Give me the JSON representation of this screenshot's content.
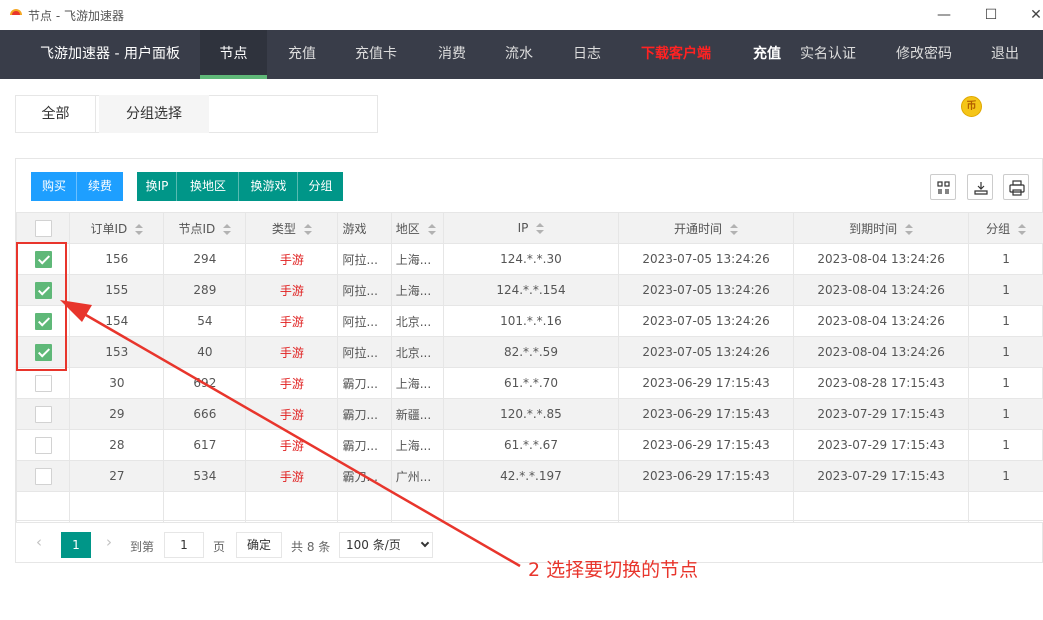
{
  "window": {
    "title": "节点 - 飞游加速器",
    "minimize": "—",
    "maximize": "☐",
    "close": "✕"
  },
  "nav": {
    "brand": "飞游加速器 - 用户面板",
    "items": [
      {
        "label": "节点"
      },
      {
        "label": "充值"
      },
      {
        "label": "充值卡"
      },
      {
        "label": "消费"
      },
      {
        "label": "流水"
      },
      {
        "label": "日志"
      },
      {
        "label": "下载客户端"
      },
      {
        "label": "充值"
      },
      {
        "label": "实名认证"
      },
      {
        "label": "修改密码"
      },
      {
        "label": "退出"
      }
    ]
  },
  "filter": {
    "all": "全部",
    "group": "分组选择"
  },
  "coin": {
    "glyph": "币",
    "color": "#f5c518"
  },
  "toolbar": {
    "buttons": [
      {
        "label": "购买"
      },
      {
        "label": "续费"
      },
      {
        "label": "换IP"
      },
      {
        "label": "换地区"
      },
      {
        "label": "换游戏"
      },
      {
        "label": "分组"
      }
    ],
    "icons": [
      "columns-icon",
      "export-icon",
      "print-icon"
    ]
  },
  "table": {
    "headers": [
      "订单ID",
      "节点ID",
      "类型",
      "游戏",
      "地区",
      "IP",
      "开通时间",
      "到期时间",
      "分组"
    ],
    "rows": [
      {
        "checked": true,
        "order_id": "156",
        "node_id": "294",
        "type": "手游",
        "game": "阿拉...",
        "region": "上海...",
        "ip": "124.*.*.30",
        "open": "2023-07-05 13:24:26",
        "expire": "2023-08-04 13:24:26",
        "group": "1"
      },
      {
        "checked": true,
        "order_id": "155",
        "node_id": "289",
        "type": "手游",
        "game": "阿拉...",
        "region": "上海...",
        "ip": "124.*.*.154",
        "open": "2023-07-05 13:24:26",
        "expire": "2023-08-04 13:24:26",
        "group": "1"
      },
      {
        "checked": true,
        "order_id": "154",
        "node_id": "54",
        "type": "手游",
        "game": "阿拉...",
        "region": "北京...",
        "ip": "101.*.*.16",
        "open": "2023-07-05 13:24:26",
        "expire": "2023-08-04 13:24:26",
        "group": "1"
      },
      {
        "checked": true,
        "order_id": "153",
        "node_id": "40",
        "type": "手游",
        "game": "阿拉...",
        "region": "北京...",
        "ip": "82.*.*.59",
        "open": "2023-07-05 13:24:26",
        "expire": "2023-08-04 13:24:26",
        "group": "1"
      },
      {
        "checked": false,
        "order_id": "30",
        "node_id": "692",
        "type": "手游",
        "game": "霸刀...",
        "region": "上海...",
        "ip": "61.*.*.70",
        "open": "2023-06-29 17:15:43",
        "expire": "2023-08-28 17:15:43",
        "group": "1"
      },
      {
        "checked": false,
        "order_id": "29",
        "node_id": "666",
        "type": "手游",
        "game": "霸刀...",
        "region": "新疆...",
        "ip": "120.*.*.85",
        "open": "2023-06-29 17:15:43",
        "expire": "2023-07-29 17:15:43",
        "group": "1"
      },
      {
        "checked": false,
        "order_id": "28",
        "node_id": "617",
        "type": "手游",
        "game": "霸刀...",
        "region": "上海...",
        "ip": "61.*.*.67",
        "open": "2023-06-29 17:15:43",
        "expire": "2023-07-29 17:15:43",
        "group": "1"
      },
      {
        "checked": false,
        "order_id": "27",
        "node_id": "534",
        "type": "手游",
        "game": "霸刀...",
        "region": "广州...",
        "ip": "42.*.*.197",
        "open": "2023-06-29 17:15:43",
        "expire": "2023-07-29 17:15:43",
        "group": "1"
      }
    ]
  },
  "pager": {
    "current": "1",
    "goto_label": "到第",
    "page_input": "1",
    "page_label": "页",
    "confirm": "确定",
    "total": "共 8 条",
    "page_size": "100 条/页"
  },
  "annotation": {
    "text": "2 选择要切换的节点",
    "color": "#e8352c"
  }
}
